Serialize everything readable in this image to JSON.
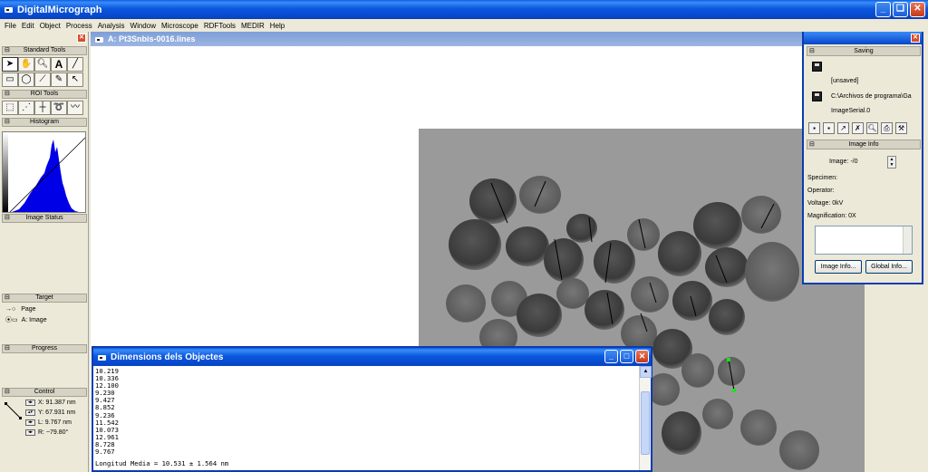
{
  "app": {
    "title": "DigitalMicrograph"
  },
  "menu": [
    "File",
    "Edit",
    "Object",
    "Process",
    "Analysis",
    "Window",
    "Microscope",
    "RDFTools",
    "MEDIR",
    "Help"
  ],
  "palette": {
    "standard_tools": "Standard Tools",
    "roi_tools": "ROI Tools",
    "histogram": "Histogram",
    "image_status": "Image Status",
    "target": "Target",
    "target_page": "Page",
    "target_image": "A: Image",
    "progress": "Progress",
    "control": "Control",
    "control_x": "X: 91.387 nm",
    "control_y": "Y: 67.931 nm",
    "control_l": "L: 9.767 nm",
    "control_r": "R: ~79.80°"
  },
  "image_window": {
    "title": "A: Pt3Snbis-0016.lines"
  },
  "info_panel": {
    "saving": "Saving",
    "unsaved": "[unsaved]",
    "path": "C:\\Archivos de programa\\Ga",
    "serial": "ImageSerial.0",
    "image_info": "Image Info",
    "image_label": "Image: -/0",
    "specimen": "Specimen:",
    "operator": "Operator:",
    "voltage": "Voltage: 0kV",
    "magnification": "Magnification: 0X",
    "image_info_btn": "Image Info...",
    "global_info_btn": "Global Info..."
  },
  "dimensions_window": {
    "title": "Dimensions dels Objectes",
    "values": [
      "10.219",
      "10.336",
      "12.100",
      "9.230",
      "9.427",
      "8.852",
      "9.236",
      "11.542",
      "10.073",
      "12.961",
      "8.728",
      "9.767"
    ],
    "summary": "Longitud Media = 10.531 ± 1.564 nm"
  },
  "icons": {
    "minimize": "_",
    "maximize": "□",
    "close": "✕",
    "restore": "❏"
  }
}
